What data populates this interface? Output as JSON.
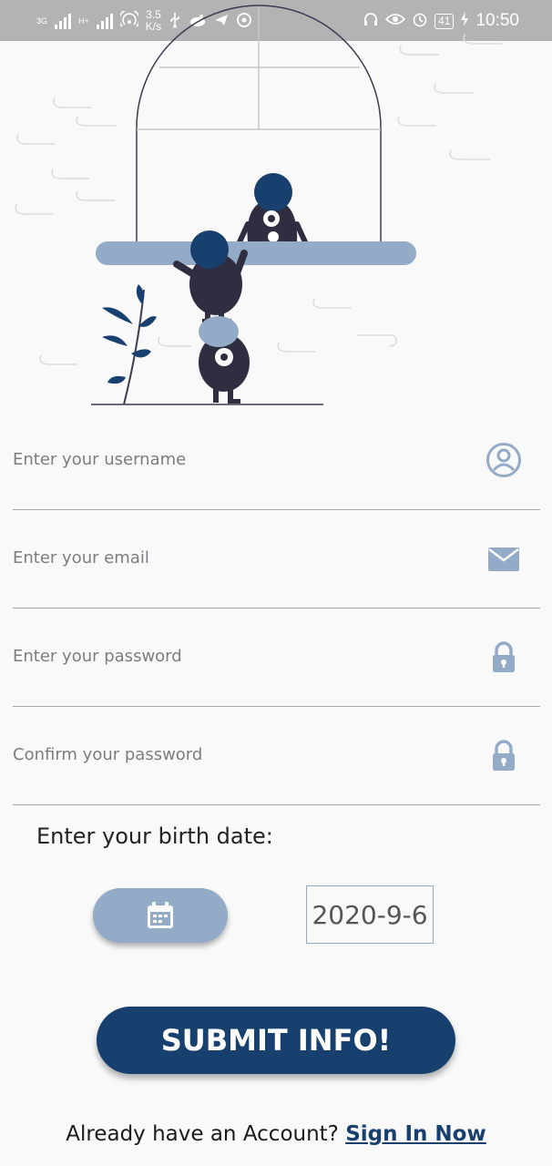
{
  "status_bar": {
    "net_labels": [
      "3G",
      "H+"
    ],
    "speed_value": "3.5",
    "speed_unit": "K/s",
    "battery": "41",
    "time": "10:50"
  },
  "form": {
    "username_placeholder": "Enter your username",
    "email_placeholder": "Enter your email",
    "password_placeholder": "Enter your password",
    "confirm_placeholder": "Confirm your password",
    "birth_label": "Enter your birth date:",
    "birth_date_value": "2020-9-6",
    "submit_label": "SUBMIT INFO!"
  },
  "footer": {
    "prompt": "Already have an Account?",
    "link": "Sign In Now"
  },
  "icons": {
    "username": "person-circle-icon",
    "email": "envelope-icon",
    "password": "lock-icon",
    "confirm": "lock-icon",
    "date": "calendar-icon"
  },
  "colors": {
    "primary": "#17406f",
    "accent": "#93abc6",
    "character": "#2f2e41"
  }
}
